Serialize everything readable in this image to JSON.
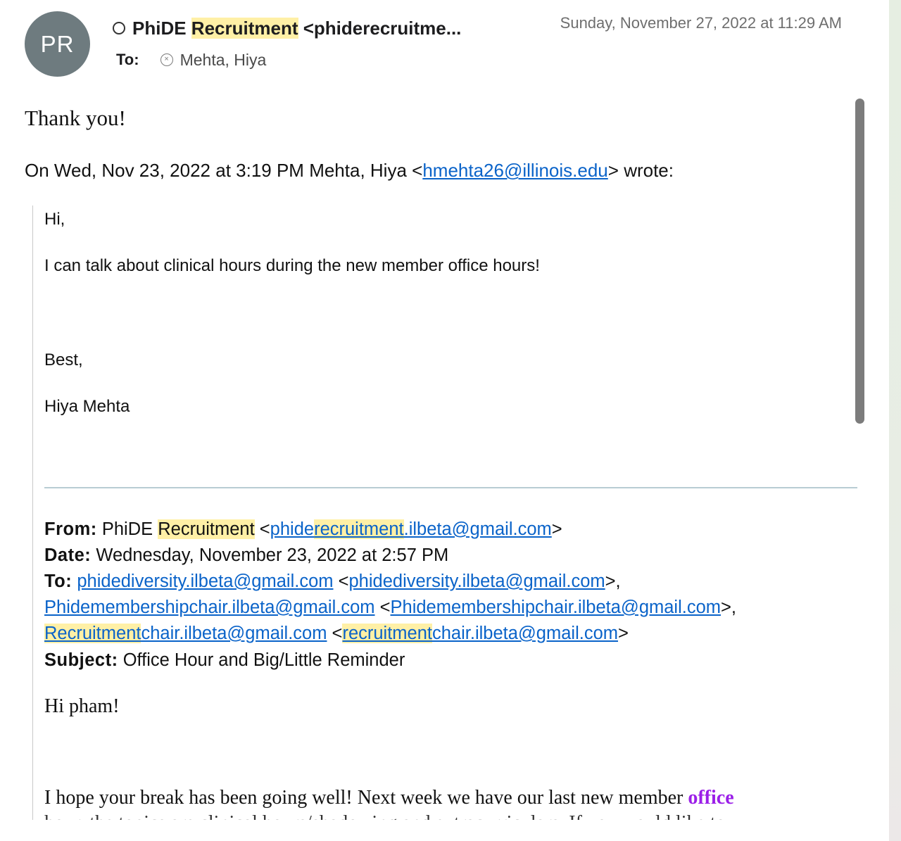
{
  "header": {
    "avatar_initials": "PR",
    "sender_prefix": "PhiDE ",
    "sender_highlight": "Recruitment",
    "sender_suffix": " <phiderecruitme...",
    "date": "Sunday, November 27, 2022 at 11:29 AM",
    "to_label": "To:",
    "to_recipient": "Mehta, Hiya"
  },
  "reply": {
    "text": "Thank you!",
    "wrote_prefix": "On Wed, Nov 23, 2022 at 3:19 PM Mehta, Hiya <",
    "wrote_email": "hmehta26@illinois.edu",
    "wrote_suffix": "> wrote:"
  },
  "quoted": {
    "greeting": "Hi,",
    "line1": "I can talk about clinical hours during the new member office hours!",
    "closing": "Best,",
    "signature": "Hiya Mehta"
  },
  "forwarded": {
    "from_label": "From:",
    "from_name_prefix": "PhiDE ",
    "from_name_highlight": "Recruitment",
    "from_email_a": "phide",
    "from_email_hl": "recruitment",
    "from_email_b": ".ilbeta@gmail.com",
    "date_label": "Date:",
    "date_value": "Wednesday, November 23, 2022 at 2:57 PM",
    "to_label": "To:",
    "to_email1": "phidediversity.ilbeta@gmail.com",
    "to_email1_bracket": "phidediversity.ilbeta@gmail.com",
    "to_email2": "Phidemembershipchair.ilbeta@gmail.com",
    "to_email2_bracket": "Phidemembershipchair.ilbeta@gmail.com",
    "to_email3_hl": "Recruitment",
    "to_email3_rest": "chair.ilbeta@gmail.com",
    "to_email3b_hl": "recruitment",
    "to_email3b_rest": "chair.ilbeta@gmail.com",
    "subject_label": "Subject:",
    "subject_value": "Office Hour and Big/Little Reminder",
    "greeting": "Hi pham!",
    "body_start": "I hope your break has been going well! Next week we have our last new member ",
    "body_bold": "office",
    "body_cut": "hour, the topics are clinical hours/shadowing and extracurriculars. If you would like to"
  }
}
